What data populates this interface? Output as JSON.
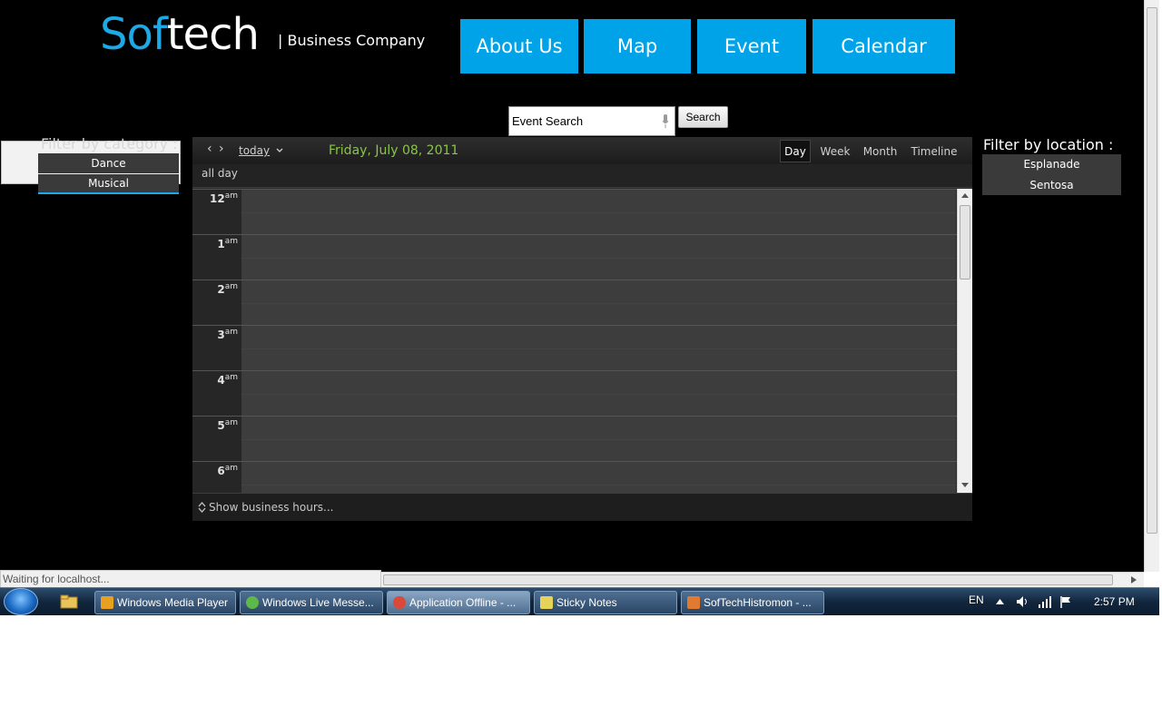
{
  "logo": {
    "part1": "Sof",
    "part2": "tech",
    "tagline": "| Business Company"
  },
  "nav": {
    "about": "About Us",
    "map": "Map",
    "event": "Event",
    "calendar": "Calendar"
  },
  "search": {
    "value": "Event Search",
    "button": "Search"
  },
  "category_filter": {
    "label": "Filter by category :",
    "items": [
      "Dance",
      "Musical"
    ]
  },
  "location_filter": {
    "label": "Filter by location :",
    "items": [
      "Esplanade",
      "Sentosa"
    ]
  },
  "calendar": {
    "prev": "‹",
    "next": "›",
    "today": "today",
    "date_title": "Friday, July 08, 2011",
    "views": [
      "Day",
      "Week",
      "Month",
      "Timeline"
    ],
    "active_view": "Day",
    "all_day": "all day",
    "hours": [
      {
        "num": "12",
        "ampm": "am"
      },
      {
        "num": "1",
        "ampm": "am"
      },
      {
        "num": "2",
        "ampm": "am"
      },
      {
        "num": "3",
        "ampm": "am"
      },
      {
        "num": "4",
        "ampm": "am"
      },
      {
        "num": "5",
        "ampm": "am"
      },
      {
        "num": "6",
        "ampm": "am"
      }
    ],
    "footer": "Show business hours..."
  },
  "browser": {
    "status": "Waiting for localhost..."
  },
  "taskbar": {
    "items": [
      {
        "label": "Windows Media Player",
        "icon_color": "#e8a020"
      },
      {
        "label": "Windows Live Messe...",
        "icon_color": "#5db84a"
      },
      {
        "label": "Application Offline - ...",
        "icon_color": "#d94a3a"
      },
      {
        "label": "Sticky Notes",
        "icon_color": "#e6d35a"
      },
      {
        "label": "SofTechHistromon - ...",
        "icon_color": "#e07a30"
      }
    ],
    "lang": "EN",
    "time": "2:57 PM"
  }
}
